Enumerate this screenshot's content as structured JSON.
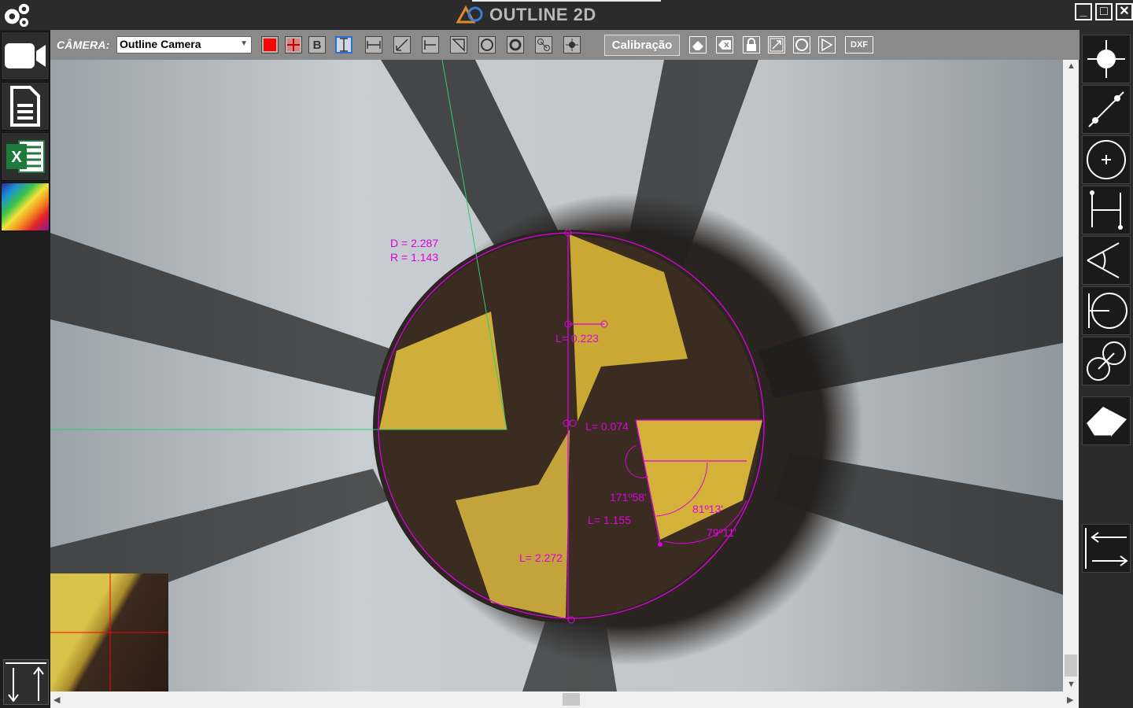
{
  "app": {
    "title": "OUTLINE 2D"
  },
  "window_controls": {
    "minimize": "_",
    "maximize": "□",
    "close": "✕"
  },
  "left_sidebar": {
    "items": [
      {
        "name": "camera",
        "icon": "video-camera-icon"
      },
      {
        "name": "report",
        "icon": "document-icon"
      },
      {
        "name": "excel",
        "icon": "excel-icon",
        "label": "X"
      },
      {
        "name": "colors",
        "icon": "color-palette-icon"
      }
    ]
  },
  "toolbar": {
    "camera_label": "CÂMERA:",
    "camera_selected": "Outline Camera",
    "bold_label": "B",
    "calibration_label": "Calibração",
    "dxf_label": "DXF",
    "color_red": "#ff0000"
  },
  "measurements": {
    "diameter": "D = 2.287",
    "radius": "R = 1.143",
    "l_0223": "L= 0.223",
    "l_0074": "L= 0.074",
    "angle_171": "171º58'",
    "l_1155": "L= 1.155",
    "angle_81": "81º13'",
    "angle_79": "79º11'",
    "l_2272": "L= 2.272"
  },
  "colors": {
    "measure": "#e000e0",
    "guide": "#2ecc71",
    "crosshair": "#ff0000"
  }
}
